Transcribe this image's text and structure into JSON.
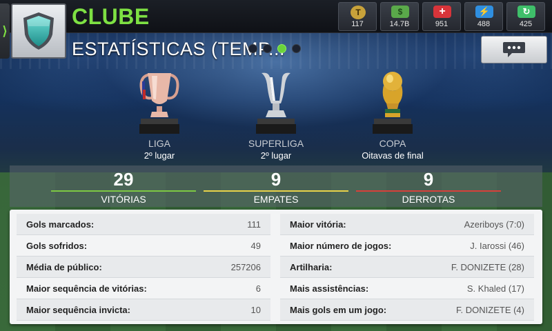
{
  "header": {
    "title": "CLUBE",
    "subtitle": "ESTATÍSTICAS (TEMP...",
    "pager": {
      "pages": 4,
      "active_index": 2
    }
  },
  "resources": [
    {
      "icon": "token-icon",
      "value": "117",
      "color": "#c8a23a"
    },
    {
      "icon": "cash-icon",
      "value": "14.7B",
      "color": "#5aa84a"
    },
    {
      "icon": "health-icon",
      "value": "951",
      "color": "#d8343a"
    },
    {
      "icon": "energy-icon",
      "value": "488",
      "color": "#2f8fe0"
    },
    {
      "icon": "training-icon",
      "value": "425",
      "color": "#3fbf6a"
    }
  ],
  "trophies": [
    {
      "name": "LIGA",
      "place": "2º lugar"
    },
    {
      "name": "SUPERLIGA",
      "place": "2º lugar"
    },
    {
      "name": "COPA",
      "place": "Oitavas de final"
    }
  ],
  "summary": [
    {
      "value": "29",
      "label": "VITÓRIAS",
      "color": "#7ec843"
    },
    {
      "value": "9",
      "label": "EMPATES",
      "color": "#e8d24a"
    },
    {
      "value": "9",
      "label": "DERROTAS",
      "color": "#d8403a"
    }
  ],
  "stats_left": [
    {
      "label": "Gols marcados:",
      "value": "111"
    },
    {
      "label": "Gols sofridos:",
      "value": "49"
    },
    {
      "label": "Média de público:",
      "value": "257206"
    },
    {
      "label": "Maior sequência de vitórias:",
      "value": "6"
    },
    {
      "label": "Maior sequência invicta:",
      "value": "10"
    }
  ],
  "stats_right": [
    {
      "label": "Maior vitória:",
      "value": "Azeriboys (7:0)"
    },
    {
      "label": "Maior número de jogos:",
      "value": "J. Iarossi (46)"
    },
    {
      "label": "Artilharia:",
      "value": "F. DONIZETE (28)"
    },
    {
      "label": "Mais assistências:",
      "value": "S. Khaled (17)"
    },
    {
      "label": "Mais gols em um jogo:",
      "value": "F. DONIZETE (4)"
    }
  ]
}
